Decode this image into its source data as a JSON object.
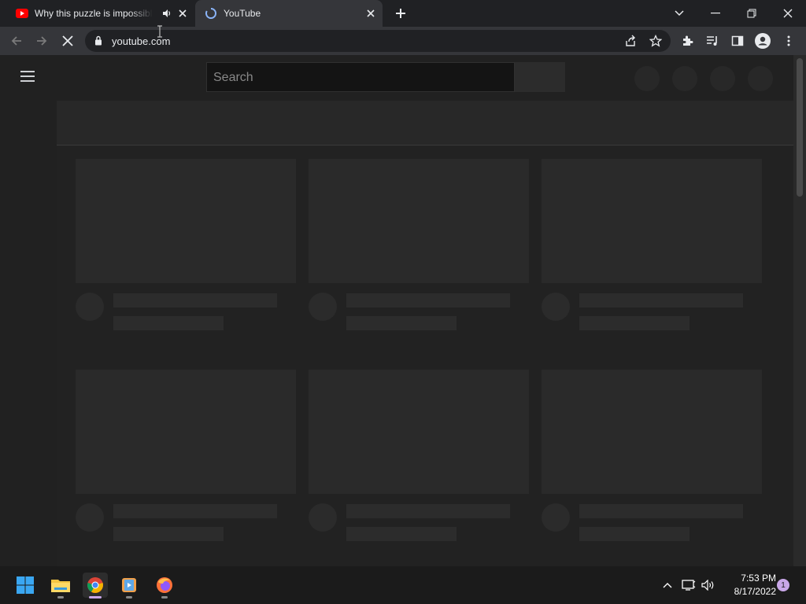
{
  "browser": {
    "tabs": [
      {
        "title": "Why this puzzle is impossible",
        "audio": "speaker-icon",
        "favicon": "youtube-icon"
      },
      {
        "title": "YouTube",
        "favicon": "loading-spinner-icon"
      }
    ],
    "address": {
      "url": "youtube.com"
    }
  },
  "youtube": {
    "search_placeholder": "Search"
  },
  "taskbar": {
    "apps": [
      "start-icon",
      "file-explorer-icon",
      "chrome-icon",
      "media-player-icon",
      "firefox-icon"
    ],
    "clock": {
      "time": "7:53 PM",
      "date": "8/17/2022"
    },
    "notification_count": "1"
  },
  "colors": {
    "accent": "#c9a7e8",
    "youtube_red": "#ff0000",
    "background": "#202020"
  }
}
